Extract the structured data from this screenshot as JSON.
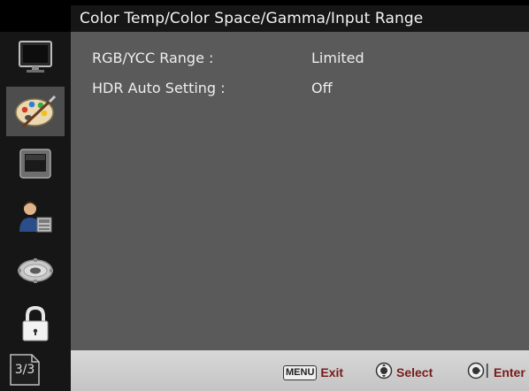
{
  "header": {
    "title": "Color Temp/Color Space/Gamma/Input Range"
  },
  "sidebar": {
    "items": [
      {
        "icon": "monitor-icon",
        "selected": false
      },
      {
        "icon": "palette-icon",
        "selected": true
      },
      {
        "icon": "picture-frame-icon",
        "selected": false
      },
      {
        "icon": "user-settings-icon",
        "selected": false
      },
      {
        "icon": "gear-icon",
        "selected": false
      },
      {
        "icon": "lock-icon",
        "selected": false
      }
    ],
    "page_indicator": "3/3"
  },
  "settings": [
    {
      "label": "RGB/YCC Range :",
      "value": "Limited"
    },
    {
      "label": "HDR Auto Setting :",
      "value": "Off"
    }
  ],
  "footer": {
    "menu_key": "MENU",
    "exit": "Exit",
    "select": "Select",
    "enter": "Enter"
  },
  "colors": {
    "content_bg": "#5a5a5a",
    "sidebar_bg": "#161616",
    "footer_bg": "#cfcfcf",
    "footer_text": "#7a1a1a"
  }
}
